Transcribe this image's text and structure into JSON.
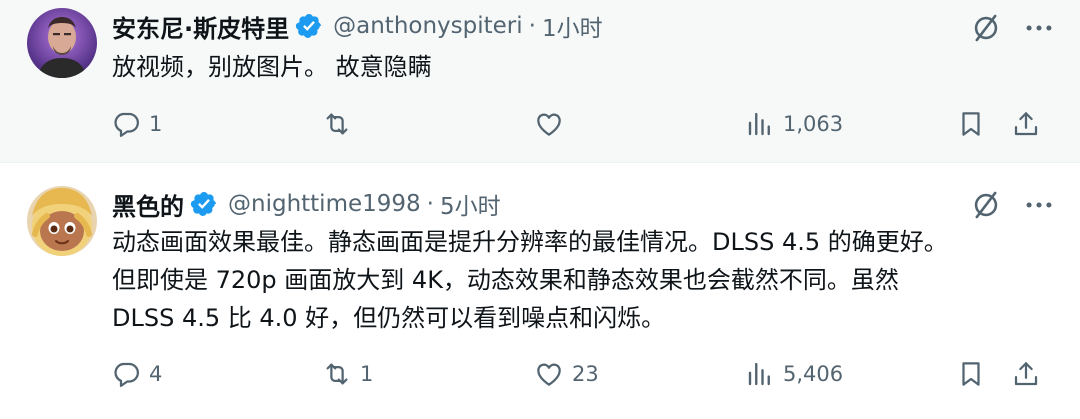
{
  "posts": [
    {
      "author": "安东尼·斯皮特里",
      "handle": "@anthonyspiteri",
      "separator": "·",
      "time": "1小时",
      "text_lines": [
        "放视频，别放图片。 故意隐瞒"
      ],
      "replies": "1",
      "reposts": "",
      "likes": "",
      "views": "1,063"
    },
    {
      "author": "黑色的",
      "handle": "@nighttime1998",
      "separator": "·",
      "time": "5小时",
      "text_lines": [
        "动态画面效果最佳。静态画面是提升分辨率的最佳情况。DLSS 4.5 的确更好。",
        "但即使是 720p 画面放大到 4K，动态效果和静态效果也会截然不同。虽然",
        "DLSS 4.5 比 4.0 好，但仍然可以看到噪点和闪烁。"
      ],
      "replies": "4",
      "reposts": "1",
      "likes": "23",
      "views": "5,406"
    }
  ],
  "colors": {
    "verified": "#1d9bf0",
    "secondary_text": "#536471",
    "primary_text": "#0f1419",
    "post1_bg": "#f7f9f9"
  },
  "icons": [
    "verified-badge-icon",
    "grok-icon",
    "more-icon",
    "reply-icon",
    "repost-icon",
    "like-icon",
    "views-icon",
    "bookmark-icon",
    "share-icon"
  ]
}
